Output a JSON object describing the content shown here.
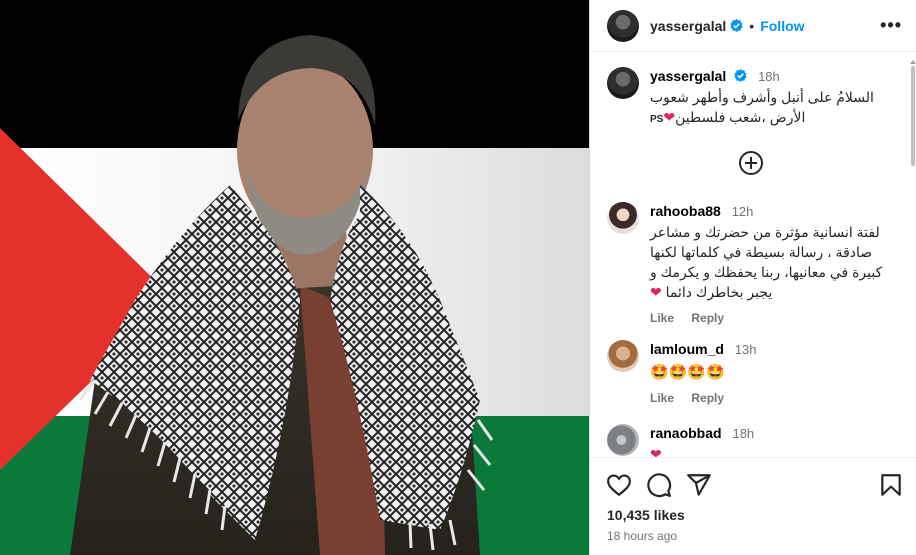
{
  "post": {
    "username": "yassergalal",
    "follow_label": "Follow",
    "more_label": "•••",
    "caption": {
      "username": "yassergalal",
      "time": "18h",
      "line1": "السلامُ على أنبل وأشرف وأطهر شعوب",
      "line2": "الأرض ،شعب فلسطين",
      "line2_suffix": "PS"
    },
    "comments": [
      {
        "username": "rahooba88",
        "time": "12h",
        "lines": [
          "لفتة انسانية مؤثرة من حضرتك و مشاعر",
          "صادقة ، رسالة بسيطة في كلماتها لكنها",
          "كبيرة في معانيها، ربنا يحفظك و يكرمك و",
          "يجبر بخاطرك دائما"
        ],
        "like_label": "Like",
        "reply_label": "Reply"
      },
      {
        "username": "lamloum_d",
        "time": "13h",
        "emojis": "🤩🤩🤩🤩",
        "like_label": "Like",
        "reply_label": "Reply"
      },
      {
        "username": "ranaobbad",
        "time": "18h",
        "heart": "❤"
      }
    ],
    "likes": "10,435 likes",
    "posted": "18 hours ago"
  },
  "icons": {
    "verified": "verified-badge-icon",
    "heart": "heart-icon",
    "comment": "comment-icon",
    "share": "share-icon",
    "save": "bookmark-icon",
    "add_comment": "plus-circle-icon"
  },
  "colors": {
    "accent": "#0095f6",
    "heart": "#e0245e",
    "flag_black": "#000000",
    "flag_white": "#f4f4f4",
    "flag_green": "#0a7a3a",
    "flag_red": "#e4312b"
  }
}
